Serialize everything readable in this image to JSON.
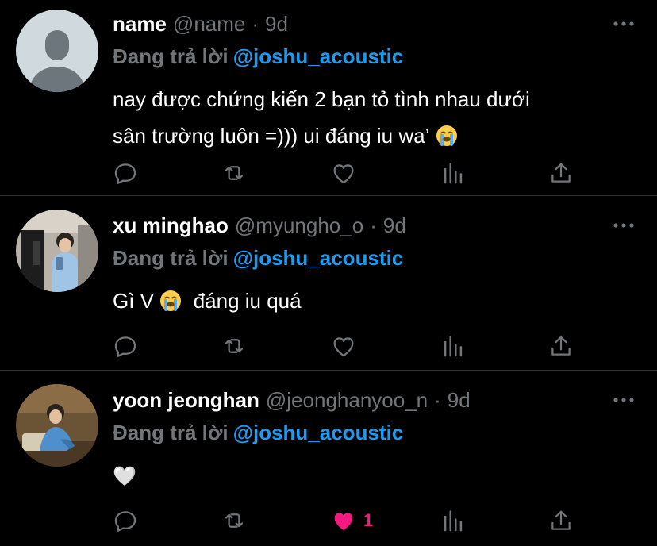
{
  "tweets": [
    {
      "display_name": "name",
      "handle": "@name",
      "separator": "·",
      "time": "9d",
      "reply_prefix": "Đang trả lời",
      "reply_to": "@joshu_acoustic",
      "text_line1": "nay được chứng kiến 2 bạn tỏ tình nhau dưới",
      "text_line2": "sân trường luôn =))) ui đáng iu wa’",
      "emoji": "loudly-crying-face",
      "liked": false,
      "like_count": ""
    },
    {
      "display_name": "xu minghao",
      "handle": "@myungho_o",
      "separator": "·",
      "time": "9d",
      "reply_prefix": "Đang trả lời",
      "reply_to": "@joshu_acoustic",
      "text_a": "Gì V",
      "text_b": "đáng iu quá",
      "emoji": "loudly-crying-face",
      "liked": false,
      "like_count": ""
    },
    {
      "display_name": "yoon jeonghan",
      "handle": "@jeonghanyoo_n",
      "separator": "·",
      "time": "9d",
      "reply_prefix": "Đang trả lời",
      "reply_to": "@joshu_acoustic",
      "text": "🤍",
      "liked": true,
      "like_count": "1"
    }
  ],
  "colors": {
    "background": "#000000",
    "muted": "#71767b",
    "link": "#1d9bf0",
    "like": "#f91880",
    "divider": "#2f3336"
  }
}
